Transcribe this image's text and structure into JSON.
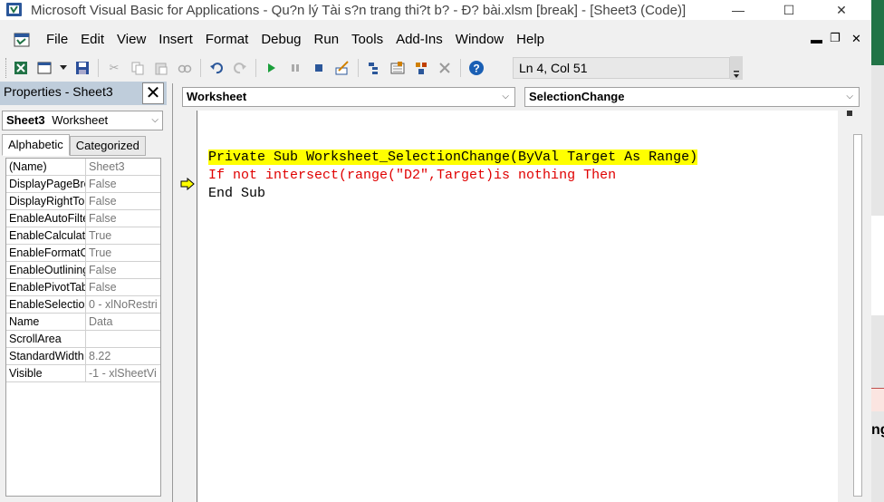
{
  "window": {
    "title": "Microsoft Visual Basic for Applications - Qu?n lý Tài s?n trang thi?t b? - Đ? bài.xlsm [break] - [Sheet3 (Code)]",
    "minimize_glyph": "—",
    "maximize_glyph": "☐",
    "close_glyph": "✕"
  },
  "menu": {
    "items": [
      "File",
      "Edit",
      "View",
      "Insert",
      "Format",
      "Debug",
      "Run",
      "Tools",
      "Add-Ins",
      "Window",
      "Help"
    ],
    "doc_min_glyph": "▬",
    "doc_restore_glyph": "❐",
    "doc_close_glyph": "✕"
  },
  "toolbar": {
    "status": "Ln 4, Col 51",
    "icons": [
      "excel-icon",
      "insert-userform-icon",
      "dropdown-icon",
      "save-icon",
      "cut-icon",
      "copy-icon",
      "paste-icon",
      "find-icon",
      "undo-icon",
      "redo-icon",
      "run-icon",
      "break-icon",
      "reset-icon",
      "design-mode-icon",
      "project-explorer-icon",
      "properties-window-icon",
      "object-browser-icon",
      "toolbox-icon",
      "help-icon"
    ]
  },
  "properties": {
    "title": "Properties - Sheet3",
    "object_name": "Sheet3",
    "object_type": "Worksheet",
    "tabs": [
      "Alphabetic",
      "Categorized"
    ],
    "rows": [
      {
        "name": "(Name)",
        "value": "Sheet3"
      },
      {
        "name": "DisplayPageBre",
        "value": "False"
      },
      {
        "name": "DisplayRightTo",
        "value": "False"
      },
      {
        "name": "EnableAutoFilte",
        "value": "False"
      },
      {
        "name": "EnableCalculati",
        "value": "True"
      },
      {
        "name": "EnableFormatC",
        "value": "True"
      },
      {
        "name": "EnableOutlining",
        "value": "False"
      },
      {
        "name": "EnablePivotTab",
        "value": "False"
      },
      {
        "name": "EnableSelection",
        "value": "0 - xlNoRestri"
      },
      {
        "name": "Name",
        "value": "Data"
      },
      {
        "name": "ScrollArea",
        "value": ""
      },
      {
        "name": "StandardWidth",
        "value": "8.22"
      },
      {
        "name": "Visible",
        "value": "-1 - xlSheetVi"
      }
    ]
  },
  "code": {
    "object_combo": "Worksheet",
    "procedure_combo": "SelectionChange",
    "lines": [
      "Private Sub Worksheet_SelectionChange(ByVal Target As Range)",
      "If not intersect(range(\"D2\",Target)is nothing Then",
      "End Sub"
    ]
  },
  "background": {
    "partial_glyph": "ng"
  },
  "colors": {
    "highlight": "#ffff00",
    "syntax_error": "#e00000",
    "excel_green": "#217346",
    "pane_header": "#bfcddb"
  }
}
